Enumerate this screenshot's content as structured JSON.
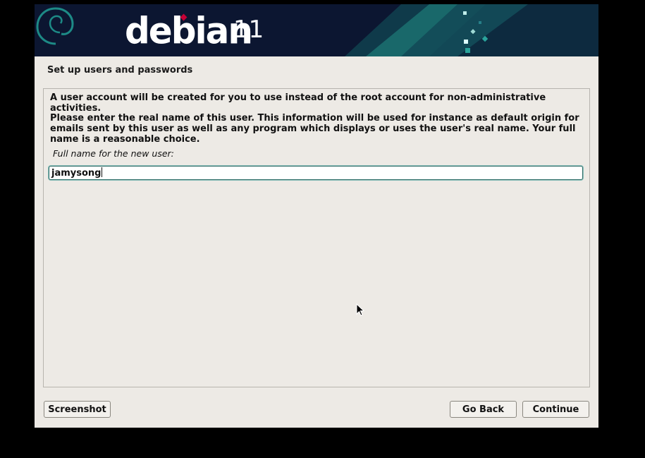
{
  "banner": {
    "logo_word": "debian",
    "logo_version": "11",
    "logo_icon": "debian-swirl-icon"
  },
  "page": {
    "title": "Set up users and passwords"
  },
  "content": {
    "intro": "A user account will be created for you to use instead of the root account for non-administrative activities.",
    "description": "Please enter the real name of this user. This information will be used for instance as default origin for emails sent by this user as well as any program which displays or uses the user's real name. Your full name is a reasonable choice.",
    "field_label": "Full name for the new user:",
    "field_value": "jamysong"
  },
  "buttons": {
    "screenshot": "Screenshot",
    "go_back": "Go Back",
    "continue": "Continue"
  },
  "colors": {
    "banner_bg": "#0c1631",
    "accent_teal": "#1d8a86",
    "debian_red": "#c70036",
    "window_bg": "#edeae5"
  }
}
